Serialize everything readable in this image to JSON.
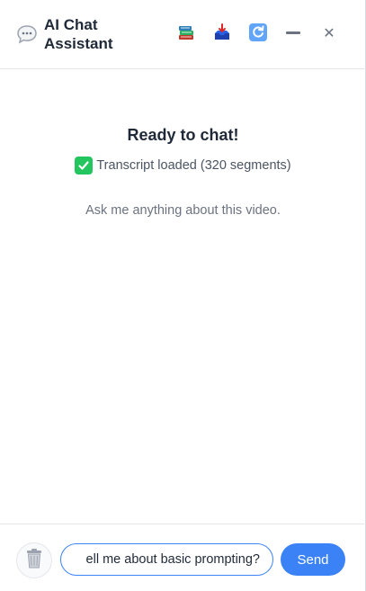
{
  "header": {
    "title": "AI Chat Assistant",
    "logo_icon": "speech-bubble-icon",
    "buttons": [
      {
        "name": "history",
        "icon": "books-icon"
      },
      {
        "name": "export",
        "icon": "inbox-tray-icon"
      },
      {
        "name": "refresh",
        "icon": "refresh-icon"
      },
      {
        "name": "minimize",
        "icon": "minimize-icon"
      },
      {
        "name": "close",
        "icon": "close-icon",
        "glyph": "✕"
      }
    ]
  },
  "main": {
    "title": "Ready to chat!",
    "status": "Transcript loaded (320 segments)",
    "hint": "Ask me anything about this video."
  },
  "footer": {
    "clear_icon": "trash-icon",
    "input_value": "ell me about basic prompting?",
    "send_label": "Send"
  },
  "colors": {
    "accent": "#3b82f6",
    "success": "#22c55e",
    "text": "#1f2937",
    "muted": "#6b7280"
  }
}
